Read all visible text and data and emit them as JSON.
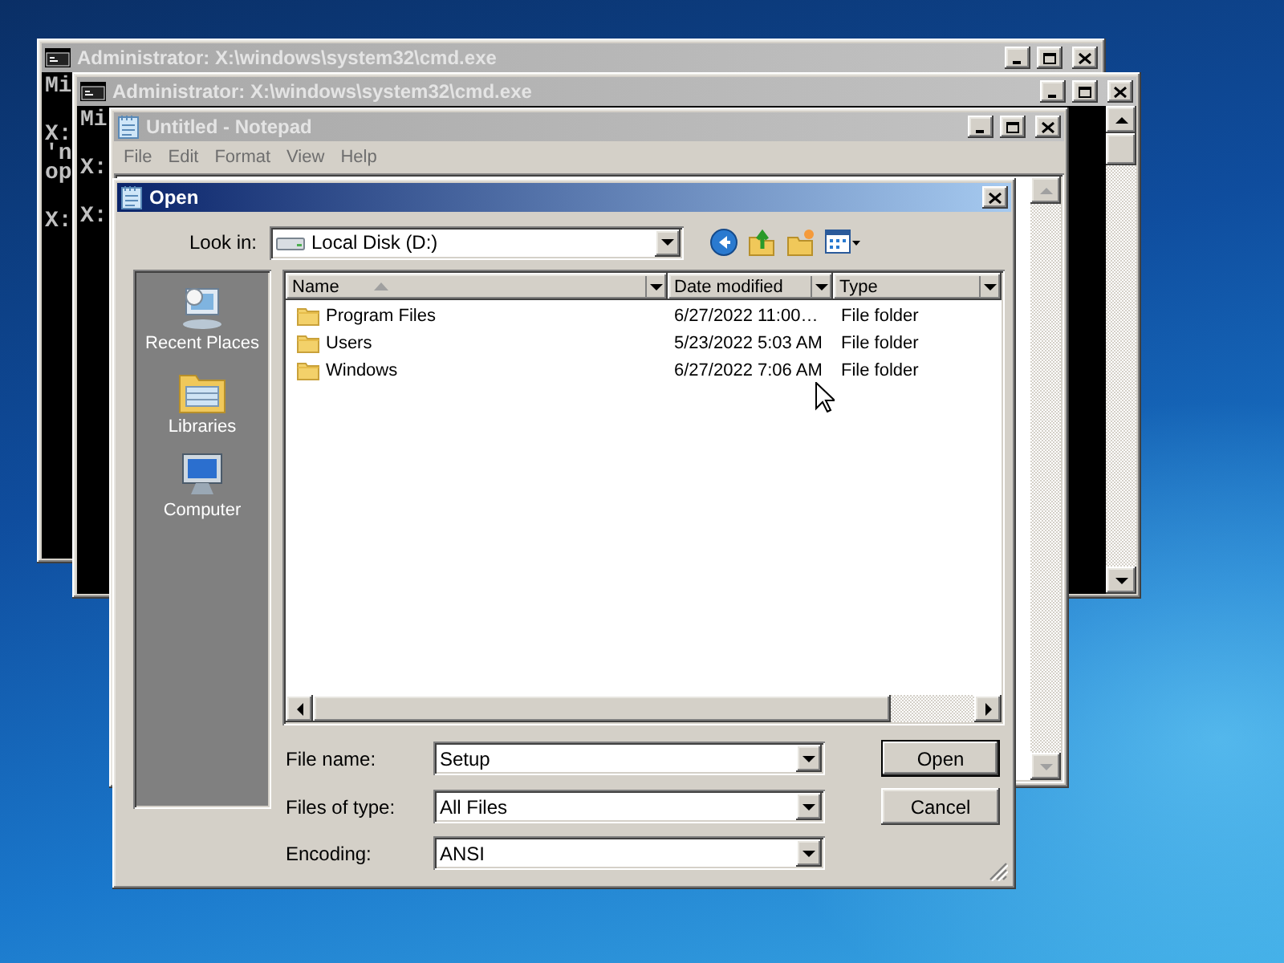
{
  "windows": [
    {
      "kind": "console",
      "title": "Administrator: X:\\windows\\system32\\cmd.exe",
      "active": false,
      "paragraphs": [
        [
          "Mi"
        ],
        [
          "X:",
          "'n",
          "op"
        ],
        [
          "X:"
        ]
      ]
    },
    {
      "kind": "console",
      "title": "Administrator: X:\\windows\\system32\\cmd.exe",
      "active": false,
      "paragraphs": [
        [
          "Mi"
        ],
        [
          "X:"
        ],
        [
          "X:"
        ]
      ]
    },
    {
      "kind": "notepad",
      "title": "Untitled - Notepad",
      "active": false,
      "menu": [
        "File",
        "Edit",
        "Format",
        "View",
        "Help"
      ]
    }
  ],
  "dialog": {
    "title": "Open",
    "active": true,
    "look_in": {
      "label": "Look in:",
      "value": "Local Disk (D:)"
    },
    "places": [
      {
        "kind": "recent",
        "label": "Recent Places"
      },
      {
        "kind": "libraries",
        "label": "Libraries"
      },
      {
        "kind": "computer",
        "label": "Computer"
      }
    ],
    "columns": [
      {
        "label": "Name",
        "sorted": true
      },
      {
        "label": "Date modified",
        "sorted": false
      },
      {
        "label": "Type",
        "sorted": false
      }
    ],
    "rows": [
      {
        "name": "Program Files",
        "date": "6/27/2022 11:00…",
        "type": "File folder",
        "selected": false
      },
      {
        "name": "Users",
        "date": "5/23/2022 5:03 AM",
        "type": "File folder",
        "selected": false
      },
      {
        "name": "Windows",
        "date": "6/27/2022 7:06 AM",
        "type": "File folder",
        "selected": false
      }
    ],
    "fields": [
      {
        "label": "File name:",
        "value": "Setup"
      },
      {
        "label": "Files of type:",
        "value": "All Files"
      },
      {
        "label": "Encoding:",
        "value": "ANSI"
      }
    ],
    "buttons": [
      {
        "label": "Open",
        "default": true
      },
      {
        "label": "Cancel",
        "default": false
      }
    ]
  }
}
